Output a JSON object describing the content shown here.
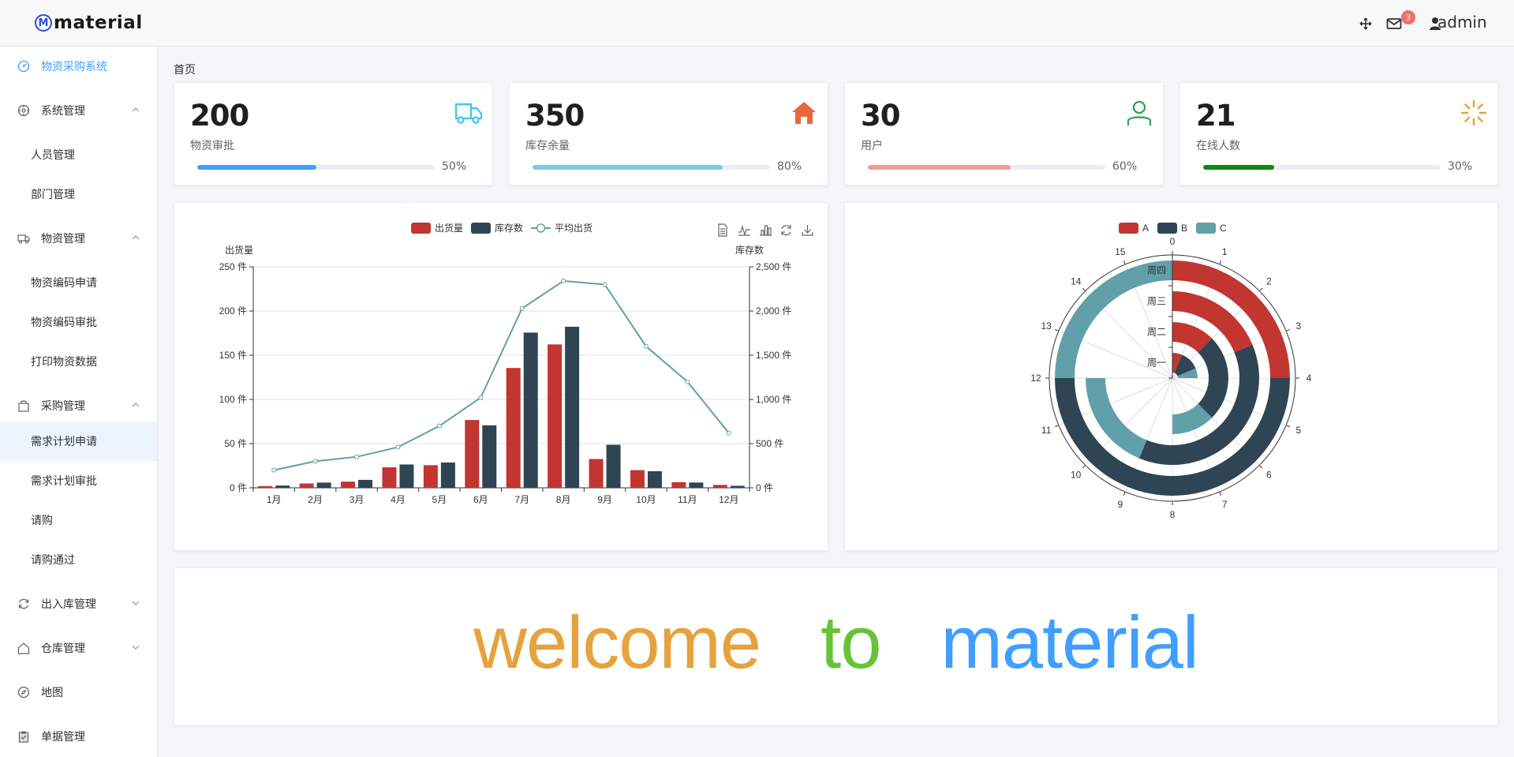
{
  "app": {
    "logo_letter": "M",
    "logo_text": "material",
    "username": "admin",
    "badge_count": "3"
  },
  "sidebar": {
    "items": [
      {
        "label": "物资采购系统",
        "icon": "dashboard-icon",
        "active": true
      },
      {
        "label": "系统管理",
        "icon": "compass-icon",
        "expanded": true,
        "children": [
          "人员管理",
          "部门管理"
        ]
      },
      {
        "label": "物资管理",
        "icon": "truck-icon",
        "expanded": true,
        "children": [
          "物资编码申请",
          "物资编码审批",
          "打印物资数据"
        ]
      },
      {
        "label": "采购管理",
        "icon": "bag-icon",
        "expanded": true,
        "children": [
          "需求计划申请",
          "需求计划审批",
          "请购",
          "请购通过"
        ]
      },
      {
        "label": "出入库管理",
        "icon": "refresh-icon",
        "expanded": false
      },
      {
        "label": "仓库管理",
        "icon": "house-icon",
        "expanded": false
      },
      {
        "label": "地图",
        "icon": "compass-icon"
      },
      {
        "label": "单据管理",
        "icon": "clipboard-icon"
      }
    ],
    "selected_child": "需求计划申请"
  },
  "breadcrumb": "首页",
  "stats": [
    {
      "value": "200",
      "label": "物资审批",
      "percent": 50,
      "percent_label": "50%",
      "color": "#409eff",
      "icon": "truck-icon",
      "icon_color": "#3bc6f5"
    },
    {
      "value": "350",
      "label": "库存余量",
      "percent": 80,
      "percent_label": "80%",
      "color": "#7ec8e3",
      "icon": "house-icon",
      "icon_color": "#e9673d"
    },
    {
      "value": "30",
      "label": "用户",
      "percent": 60,
      "percent_label": "60%",
      "color": "#f39b9b",
      "icon": "user-icon",
      "icon_color": "#2aa052"
    },
    {
      "value": "21",
      "label": "在线人数",
      "percent": 30,
      "percent_label": "30%",
      "color": "#0a8a0a",
      "icon": "loading-icon",
      "icon_color": "#e6a23c"
    }
  ],
  "chart_data": [
    {
      "type": "bar",
      "legend": [
        "出货量",
        "库存数",
        "平均出货"
      ],
      "categories": [
        "1月",
        "2月",
        "3月",
        "4月",
        "5月",
        "6月",
        "7月",
        "8月",
        "9月",
        "10月",
        "11月",
        "12月"
      ],
      "series": [
        {
          "name": "出货量",
          "type": "bar",
          "axis": "left",
          "color": "#c23531",
          "values": [
            2,
            4.9,
            7,
            23.2,
            25.6,
            76.7,
            135.6,
            162.2,
            32.6,
            20,
            6.4,
            3.3
          ]
        },
        {
          "name": "库存数",
          "type": "bar",
          "axis": "right",
          "color": "#2f4554",
          "values": [
            26,
            59,
            90,
            264,
            287,
            707,
            1756,
            1822,
            487,
            188,
            60,
            23
          ]
        },
        {
          "name": "平均出货",
          "type": "line",
          "axis": "right",
          "color": "#61a0a8",
          "values": [
            200,
            300,
            350,
            460,
            700,
            1020,
            2030,
            2340,
            2300,
            1600,
            1200,
            620
          ]
        }
      ],
      "ylabel_left": "出货量",
      "ylabel_right": "库存数",
      "ylim_left": [
        0,
        250
      ],
      "ylim_right": [
        0,
        2500
      ],
      "left_ticks": [
        "0 件",
        "50 件",
        "100 件",
        "150 件",
        "200 件",
        "250 件"
      ],
      "right_ticks": [
        "0 件",
        "500 件",
        "1,000 件",
        "1,500 件",
        "2,000 件",
        "2,500 件"
      ],
      "toolbox": [
        "data-view-icon",
        "line-chart-icon",
        "bar-chart-icon",
        "restore-icon",
        "download-icon"
      ],
      "grid": true,
      "legend_position": "top-center"
    },
    {
      "type": "polar-stacked-bar",
      "legend": [
        "A",
        "B",
        "C"
      ],
      "categories": [
        "周一",
        "周二",
        "周三",
        "周四"
      ],
      "angle_ticks": [
        "0",
        "1",
        "2",
        "3",
        "4",
        "5",
        "6",
        "7",
        "8",
        "9",
        "10",
        "11",
        "12",
        "13",
        "14",
        "15"
      ],
      "angle_max": 16,
      "series": [
        {
          "name": "A",
          "color": "#c23531",
          "values": [
            1,
            2,
            3,
            4
          ]
        },
        {
          "name": "B",
          "color": "#2f4554",
          "values": [
            2,
            4,
            6,
            8
          ]
        },
        {
          "name": "C",
          "color": "#61a0a8",
          "values": [
            1,
            2,
            3,
            4
          ]
        }
      ],
      "legend_position": "top-center"
    }
  ],
  "welcome": {
    "w1": "welcome",
    "w2": "to",
    "w3": "material",
    "c1": "#e6a23c",
    "c2": "#67c23a",
    "c3": "#409eff"
  }
}
